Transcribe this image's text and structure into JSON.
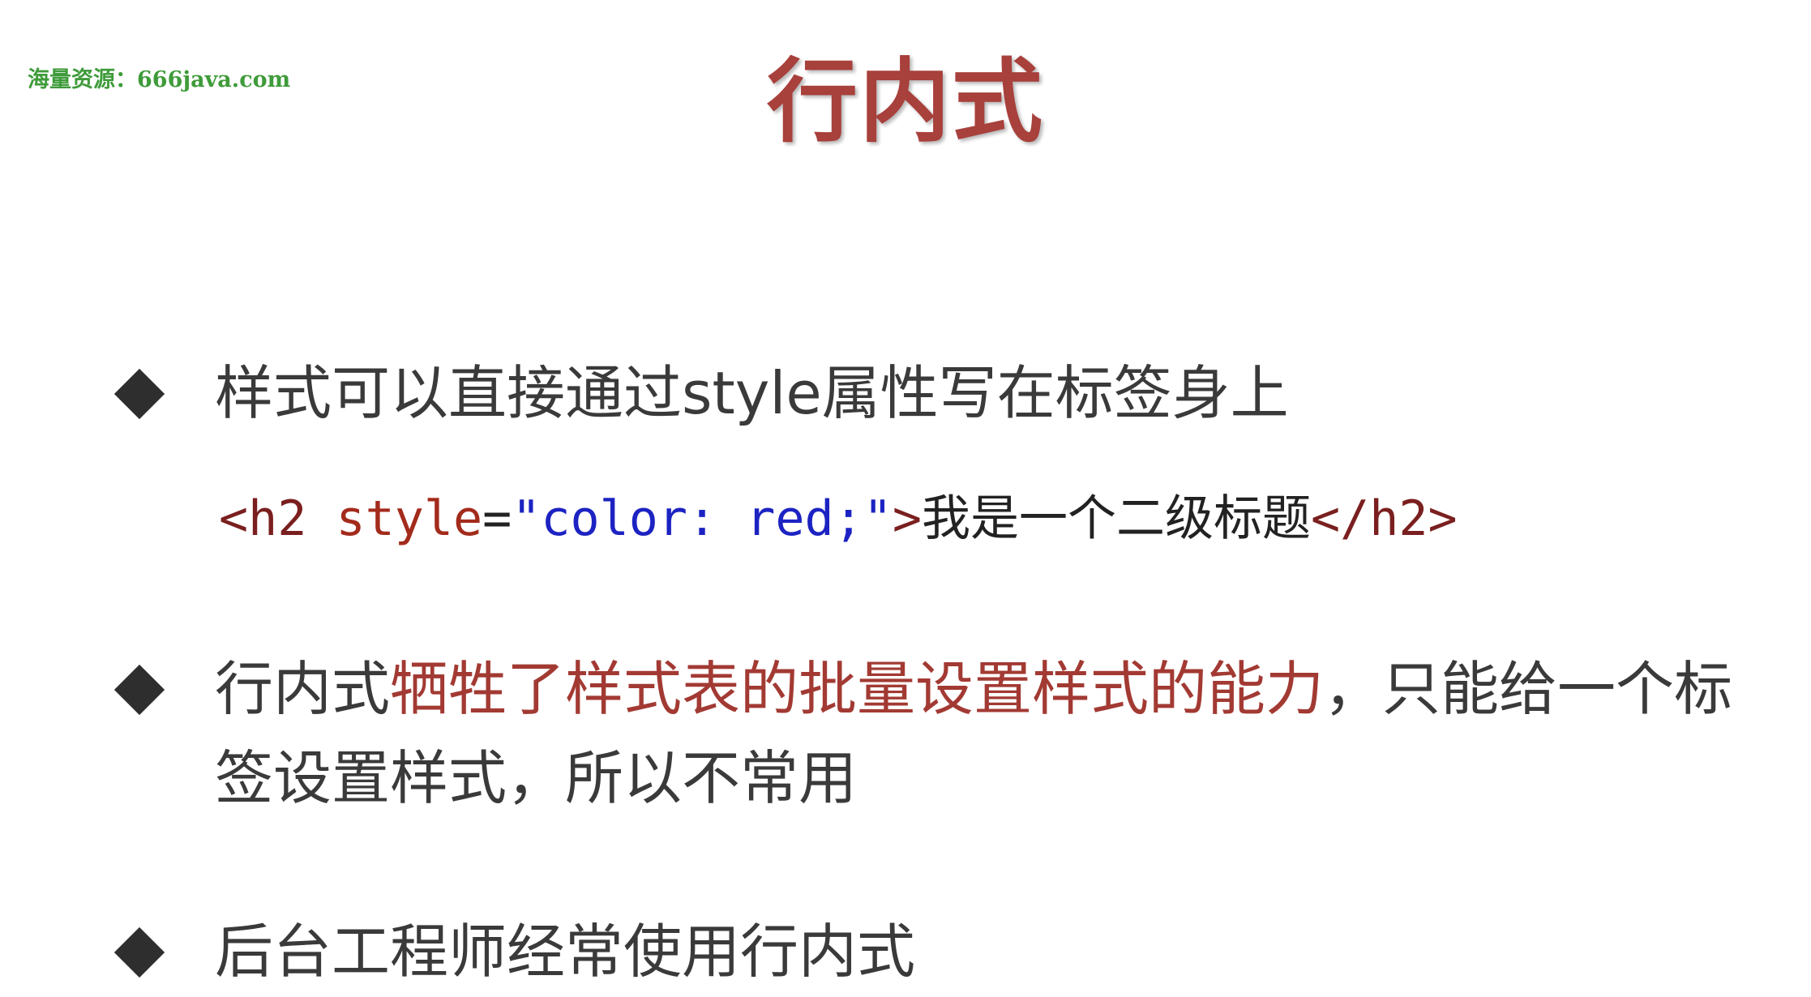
{
  "watermark": "海量资源：666java.com",
  "title": "行内式",
  "bullets": [
    {
      "text": "样式可以直接通过style属性写在标签身上"
    },
    {
      "prefix": "行内式",
      "highlight": "牺牲了样式表的批量设置样式的能力",
      "suffix": "，只能给一个标",
      "line2": "签设置样式，所以不常用"
    },
    {
      "text": "后台工程师经常使用行内式"
    }
  ],
  "code": {
    "open_tag": "<h2",
    "attr": "style",
    "eq": "=",
    "value": "\"color: red;\"",
    "close_open": ">",
    "content": "我是一个二级标题",
    "close_tag": "</h2>"
  },
  "colors": {
    "title": "#a8403c",
    "highlight": "#a23a33",
    "watermark": "#3f9b3a",
    "code_value": "#1c23c2",
    "code_attr": "#a32b1c"
  },
  "icons": {
    "bullet": "diamond-icon"
  }
}
